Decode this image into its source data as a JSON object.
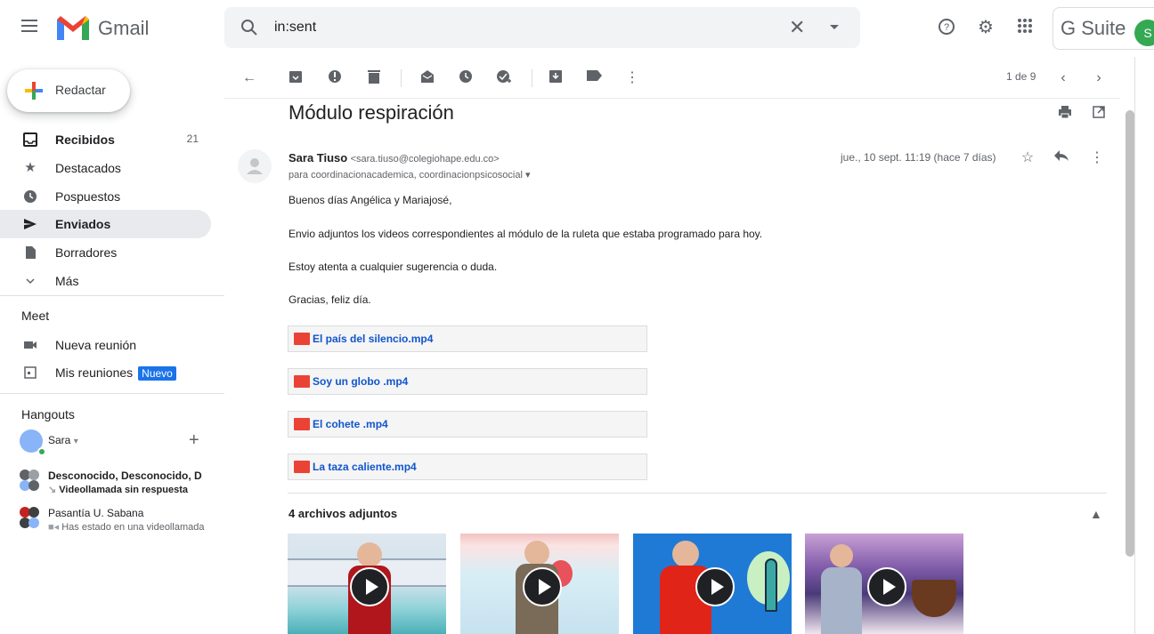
{
  "header": {
    "app_name": "Gmail",
    "search_value": "in:sent",
    "gsuite_label": "G Suite",
    "avatar_letter": "S"
  },
  "compose": {
    "label": "Redactar"
  },
  "sidebar": {
    "items": [
      {
        "label": "Recibidos",
        "count": "21",
        "icon": "inbox-icon"
      },
      {
        "label": "Destacados",
        "count": "",
        "icon": "star-icon"
      },
      {
        "label": "Pospuestos",
        "count": "",
        "icon": "clock-icon"
      },
      {
        "label": "Enviados",
        "count": "",
        "icon": "send-icon"
      },
      {
        "label": "Borradores",
        "count": "",
        "icon": "draft-icon"
      },
      {
        "label": "Más",
        "count": "",
        "icon": "chevron-down-icon"
      }
    ],
    "meet_title": "Meet",
    "meet_items": [
      {
        "label": "Nueva reunión"
      },
      {
        "label": "Mis reuniones",
        "badge": "Nuevo"
      }
    ],
    "hangouts_title": "Hangouts",
    "hangouts_user": "Sara",
    "hangouts_conversations": [
      {
        "title": "Desconocido, Desconocido, D",
        "subtitle": "Videollamada sin respuesta"
      },
      {
        "title": "Pasantía U. Sabana",
        "subtitle": "Has estado en una videollamada"
      }
    ]
  },
  "toolbar": {
    "pagination": "1 de 9"
  },
  "email": {
    "subject": "Módulo respiración",
    "sender_name": "Sara Tiuso",
    "sender_email": "<sara.tiuso@colegiohape.edu.co>",
    "to": "para coordinacionacademica, coordinacionpsicosocial",
    "date": "jue., 10 sept. 11:19 (hace 7 días)",
    "body": [
      "Buenos días Angélica y Mariajosé,",
      "Envio adjuntos los videos correspondientes al módulo de la ruleta que estaba programado para hoy.",
      "Estoy atenta a cualquier sugerencia o duda.",
      "Gracias, feliz día."
    ],
    "attachments": [
      "El país del silencio.mp4",
      "Soy un globo .mp4",
      "El cohete .mp4",
      "La taza caliente.mp4"
    ],
    "attachments_title": "4 archivos adjuntos"
  },
  "colors": {
    "accent": "#1a73e8",
    "active_bg": "#e8eaed",
    "link": "#1155cc",
    "video_icon": "#ea4335"
  }
}
